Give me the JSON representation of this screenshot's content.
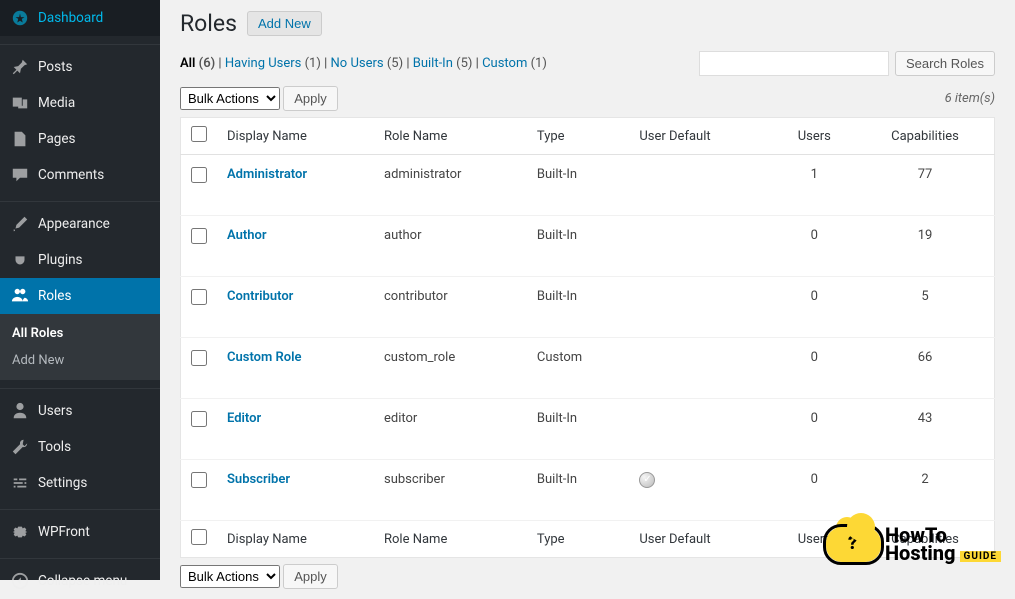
{
  "sidebar": {
    "items": [
      {
        "label": "Dashboard",
        "icon": "dashboard"
      },
      {
        "label": "Posts",
        "icon": "pin"
      },
      {
        "label": "Media",
        "icon": "media"
      },
      {
        "label": "Pages",
        "icon": "pages"
      },
      {
        "label": "Comments",
        "icon": "comment"
      },
      {
        "label": "Appearance",
        "icon": "brush"
      },
      {
        "label": "Plugins",
        "icon": "plug"
      },
      {
        "label": "Roles",
        "icon": "users",
        "active": true
      },
      {
        "label": "Users",
        "icon": "user"
      },
      {
        "label": "Tools",
        "icon": "wrench"
      },
      {
        "label": "Settings",
        "icon": "sliders"
      },
      {
        "label": "WPFront",
        "icon": "gear"
      },
      {
        "label": "Collapse menu",
        "icon": "collapse"
      }
    ],
    "submenu": [
      {
        "label": "All Roles",
        "current": true
      },
      {
        "label": "Add New"
      }
    ]
  },
  "header": {
    "title": "Roles",
    "add_new": "Add New"
  },
  "filters": {
    "all_label": "All",
    "all_count": "(6)",
    "having_label": "Having Users",
    "having_count": "(1)",
    "no_label": "No Users",
    "no_count": "(5)",
    "builtin_label": "Built-In",
    "builtin_count": "(5)",
    "custom_label": "Custom",
    "custom_count": "(1)"
  },
  "search": {
    "button": "Search Roles"
  },
  "bulk": {
    "action_label": "Bulk Actions",
    "apply": "Apply"
  },
  "items_count": "6 item(s)",
  "columns": {
    "display": "Display Name",
    "role": "Role Name",
    "type": "Type",
    "default": "User Default",
    "users": "Users",
    "caps": "Capabilities"
  },
  "rows": [
    {
      "display": "Administrator",
      "role": "administrator",
      "type": "Built-In",
      "default": false,
      "users": "1",
      "caps": "77"
    },
    {
      "display": "Author",
      "role": "author",
      "type": "Built-In",
      "default": false,
      "users": "0",
      "caps": "19"
    },
    {
      "display": "Contributor",
      "role": "contributor",
      "type": "Built-In",
      "default": false,
      "users": "0",
      "caps": "5"
    },
    {
      "display": "Custom Role",
      "role": "custom_role",
      "type": "Custom",
      "default": false,
      "users": "0",
      "caps": "66"
    },
    {
      "display": "Editor",
      "role": "editor",
      "type": "Built-In",
      "default": false,
      "users": "0",
      "caps": "43"
    },
    {
      "display": "Subscriber",
      "role": "subscriber",
      "type": "Built-In",
      "default": true,
      "users": "0",
      "caps": "2"
    }
  ],
  "watermark": {
    "line1": "HowTo",
    "line2": "Hosting",
    "guide": "GUIDE"
  }
}
